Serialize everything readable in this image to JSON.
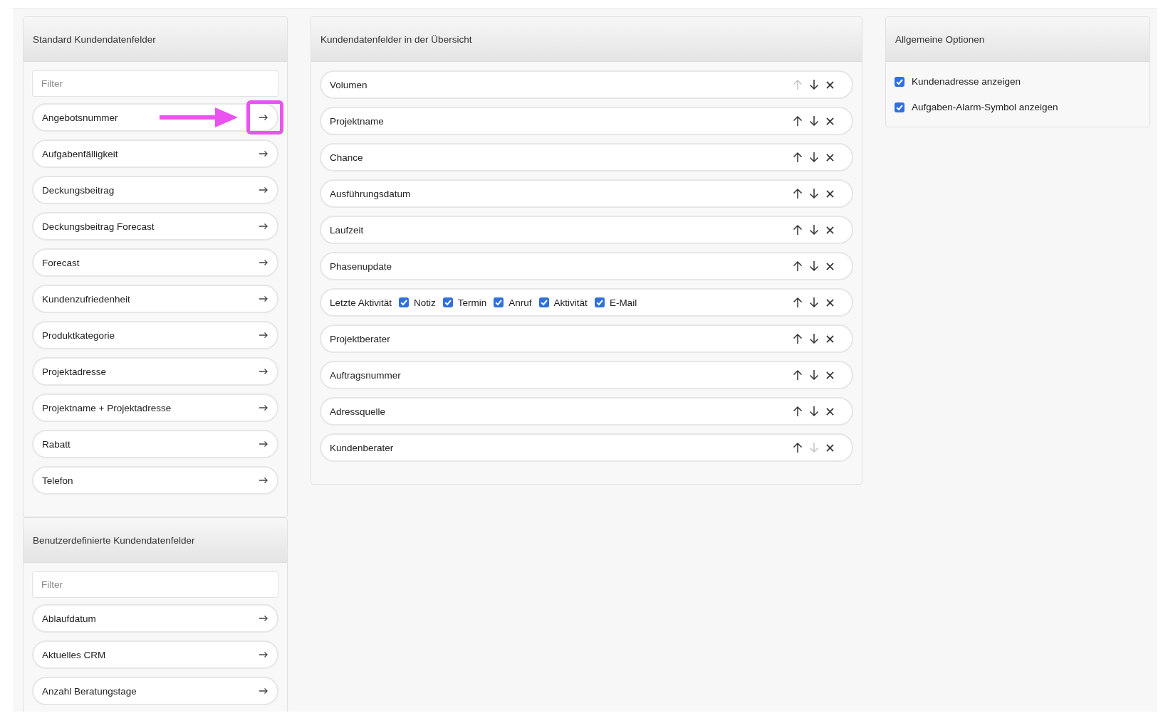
{
  "standard_fields": {
    "title": "Standard Kundendatenfelder",
    "filter": {
      "placeholder": "Filter"
    },
    "items": [
      {
        "label": "Angebotsnummer",
        "highlighted": true
      },
      {
        "label": "Aufgabenfälligkeit",
        "highlighted": false
      },
      {
        "label": "Deckungsbeitrag",
        "highlighted": false
      },
      {
        "label": "Deckungsbeitrag Forecast",
        "highlighted": false
      },
      {
        "label": "Forecast",
        "highlighted": false
      },
      {
        "label": "Kundenzufriedenheit",
        "highlighted": false
      },
      {
        "label": "Produktkategorie",
        "highlighted": false
      },
      {
        "label": "Projektadresse",
        "highlighted": false
      },
      {
        "label": "Projektname + Projektadresse",
        "highlighted": false
      },
      {
        "label": "Rabatt",
        "highlighted": false
      },
      {
        "label": "Telefon",
        "highlighted": false
      }
    ]
  },
  "custom_fields": {
    "title": "Benutzerdefinierte Kundendatenfelder",
    "filter": {
      "placeholder": "Filter"
    },
    "items": [
      {
        "label": "Ablaufdatum",
        "highlighted": false
      },
      {
        "label": "Aktuelles CRM",
        "highlighted": false
      },
      {
        "label": "Anzahl Beratungstage",
        "highlighted": false
      }
    ]
  },
  "overview_fields": {
    "title": "Kundendatenfelder in der Übersicht",
    "items": [
      {
        "kind": "plain",
        "label": "Volumen",
        "up_disabled": true,
        "down_disabled": false
      },
      {
        "kind": "plain",
        "label": "Projektname",
        "up_disabled": false,
        "down_disabled": false
      },
      {
        "kind": "plain",
        "label": "Chance",
        "up_disabled": false,
        "down_disabled": false
      },
      {
        "kind": "plain",
        "label": "Ausführungsdatum",
        "up_disabled": false,
        "down_disabled": false
      },
      {
        "kind": "plain",
        "label": "Laufzeit",
        "up_disabled": false,
        "down_disabled": false
      },
      {
        "kind": "plain",
        "label": "Phasenupdate",
        "up_disabled": false,
        "down_disabled": false
      },
      {
        "kind": "options",
        "label": "Letzte Aktivität",
        "up_disabled": false,
        "down_disabled": false,
        "options": [
          {
            "label": "Notiz",
            "checked": true
          },
          {
            "label": "Termin",
            "checked": true
          },
          {
            "label": "Anruf",
            "checked": true
          },
          {
            "label": "Aktivität",
            "checked": true
          },
          {
            "label": "E-Mail",
            "checked": true
          }
        ]
      },
      {
        "kind": "plain",
        "label": "Projektberater",
        "up_disabled": false,
        "down_disabled": false
      },
      {
        "kind": "plain",
        "label": "Auftragsnummer",
        "up_disabled": false,
        "down_disabled": false
      },
      {
        "kind": "plain",
        "label": "Adressquelle",
        "up_disabled": false,
        "down_disabled": false
      },
      {
        "kind": "plain",
        "label": "Kundenberater",
        "up_disabled": false,
        "down_disabled": true
      }
    ]
  },
  "general_options": {
    "title": "Allgemeine Optionen",
    "options": [
      {
        "label": "Kundenadresse anzeigen",
        "checked": true
      },
      {
        "label": "Aufgaben-Alarm-Symbol anzeigen",
        "checked": true
      }
    ]
  }
}
